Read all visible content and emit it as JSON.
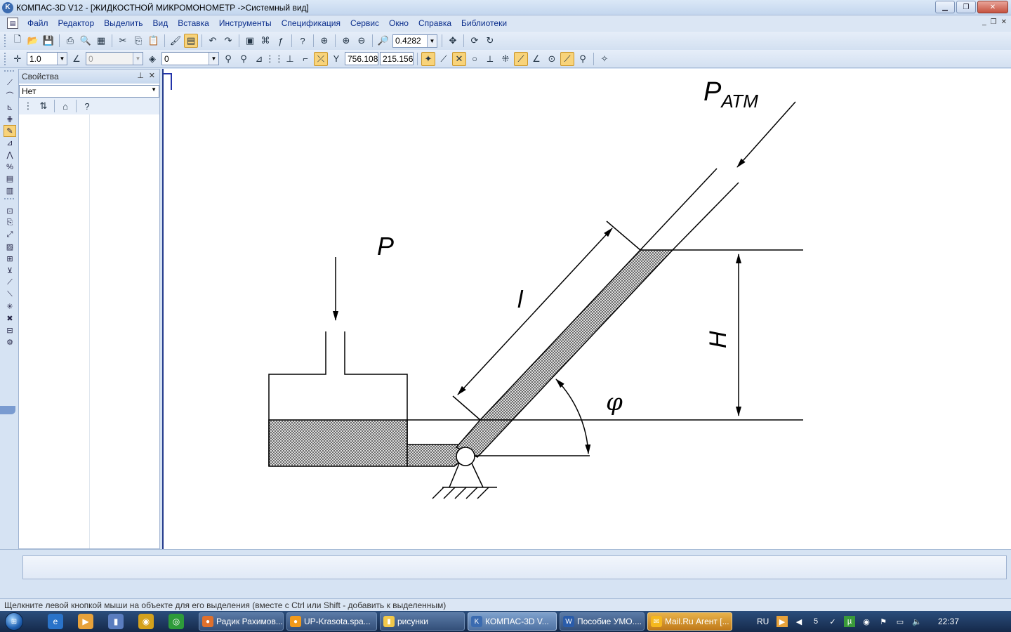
{
  "window": {
    "title": "КОМПАС-3D V12 - [ЖИДКОСТНОЙ МИКРОМОНОМЕТР ->Системный вид]"
  },
  "menu": [
    "Файл",
    "Редактор",
    "Выделить",
    "Вид",
    "Вставка",
    "Инструменты",
    "Спецификация",
    "Сервис",
    "Окно",
    "Справка",
    "Библиотеки"
  ],
  "toolbar1": {
    "zoom_value": "0.4282"
  },
  "toolbar2": {
    "step_value": "1.0",
    "angle_value": "0",
    "layer_value": "0",
    "coord_x": "756.108",
    "coord_y": "215.156"
  },
  "props_panel": {
    "title": "Свойства",
    "filter_value": "Нет"
  },
  "drawing": {
    "label_p_atm_main": "P",
    "label_p_atm_sub": "АТМ",
    "label_p": "P",
    "label_l": "l",
    "label_h": "H",
    "label_phi": "φ"
  },
  "status": {
    "hint": "Щелкните левой кнопкой мыши на объекте для его выделения (вместе с Ctrl или Shift - добавить к выделенным)"
  },
  "taskbar": {
    "tasks": [
      {
        "label": "Радик Рахимов...",
        "color": "#e0702c"
      },
      {
        "label": "UP-Krasota.spa...",
        "color": "#f29a1a"
      },
      {
        "label": "рисунки",
        "color": "#f1c84a"
      },
      {
        "label": "КОМПАС-3D V...",
        "color": "#3b6bb0"
      },
      {
        "label": "Пособие УМО....",
        "color": "#2a5caa"
      },
      {
        "label": "Mail.Ru Агент [...",
        "color": "#f5b81e"
      }
    ],
    "lang": "RU",
    "clock": "22:37"
  }
}
